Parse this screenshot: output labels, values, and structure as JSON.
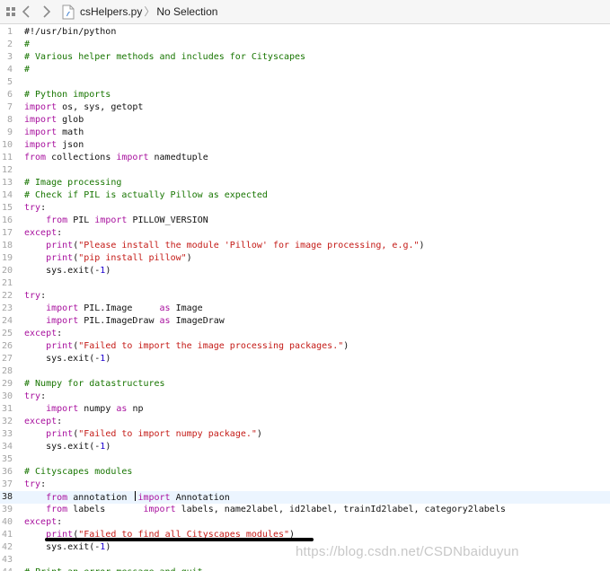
{
  "toolbar": {
    "file_name": "csHelpers.py",
    "breadcrumb_sep": "〉",
    "selection": "No Selection",
    "icons": [
      "grid-icon",
      "back-arrow-icon",
      "forward-arrow-icon",
      "python-file-icon"
    ]
  },
  "editor": {
    "current_line": 38,
    "lines": [
      {
        "n": "1",
        "tokens": [
          [
            "t",
            "#!/usr/bin/python"
          ]
        ]
      },
      {
        "n": "2",
        "tokens": [
          [
            "c",
            "#"
          ]
        ]
      },
      {
        "n": "3",
        "tokens": [
          [
            "c",
            "# Various helper methods and includes for Cityscapes"
          ]
        ]
      },
      {
        "n": "4",
        "tokens": [
          [
            "c",
            "#"
          ]
        ]
      },
      {
        "n": "5",
        "tokens": []
      },
      {
        "n": "6",
        "tokens": [
          [
            "c",
            "# Python imports"
          ]
        ]
      },
      {
        "n": "7",
        "tokens": [
          [
            "k",
            "import"
          ],
          [
            "t",
            " os, sys, getopt"
          ]
        ]
      },
      {
        "n": "8",
        "tokens": [
          [
            "k",
            "import"
          ],
          [
            "t",
            " glob"
          ]
        ]
      },
      {
        "n": "9",
        "tokens": [
          [
            "k",
            "import"
          ],
          [
            "t",
            " math"
          ]
        ]
      },
      {
        "n": "10",
        "tokens": [
          [
            "k",
            "import"
          ],
          [
            "t",
            " json"
          ]
        ]
      },
      {
        "n": "11",
        "tokens": [
          [
            "k",
            "from"
          ],
          [
            "t",
            " collections "
          ],
          [
            "k",
            "import"
          ],
          [
            "t",
            " namedtuple"
          ]
        ]
      },
      {
        "n": "12",
        "tokens": []
      },
      {
        "n": "13",
        "tokens": [
          [
            "c",
            "# Image processing"
          ]
        ]
      },
      {
        "n": "14",
        "tokens": [
          [
            "c",
            "# Check if PIL is actually Pillow as expected"
          ]
        ]
      },
      {
        "n": "15",
        "tokens": [
          [
            "k",
            "try"
          ],
          [
            "t",
            ":"
          ]
        ]
      },
      {
        "n": "16",
        "tokens": [
          [
            "t",
            "    "
          ],
          [
            "k",
            "from"
          ],
          [
            "t",
            " PIL "
          ],
          [
            "k",
            "import"
          ],
          [
            "t",
            " PILLOW_VERSION"
          ]
        ]
      },
      {
        "n": "17",
        "tokens": [
          [
            "k",
            "except"
          ],
          [
            "t",
            ":"
          ]
        ]
      },
      {
        "n": "18",
        "tokens": [
          [
            "t",
            "    "
          ],
          [
            "k",
            "print"
          ],
          [
            "t",
            "("
          ],
          [
            "s",
            "\"Please install the module 'Pillow' for image processing, e.g.\""
          ],
          [
            "t",
            ")"
          ]
        ]
      },
      {
        "n": "19",
        "tokens": [
          [
            "t",
            "    "
          ],
          [
            "k",
            "print"
          ],
          [
            "t",
            "("
          ],
          [
            "s",
            "\"pip install pillow\""
          ],
          [
            "t",
            ")"
          ]
        ]
      },
      {
        "n": "20",
        "tokens": [
          [
            "t",
            "    sys.exit(-"
          ],
          [
            "n",
            "1"
          ],
          [
            "t",
            ")"
          ]
        ]
      },
      {
        "n": "21",
        "tokens": []
      },
      {
        "n": "22",
        "tokens": [
          [
            "k",
            "try"
          ],
          [
            "t",
            ":"
          ]
        ]
      },
      {
        "n": "23",
        "tokens": [
          [
            "t",
            "    "
          ],
          [
            "k",
            "import"
          ],
          [
            "t",
            " PIL.Image     "
          ],
          [
            "k",
            "as"
          ],
          [
            "t",
            " Image"
          ]
        ]
      },
      {
        "n": "24",
        "tokens": [
          [
            "t",
            "    "
          ],
          [
            "k",
            "import"
          ],
          [
            "t",
            " PIL.ImageDraw "
          ],
          [
            "k",
            "as"
          ],
          [
            "t",
            " ImageDraw"
          ]
        ]
      },
      {
        "n": "25",
        "tokens": [
          [
            "k",
            "except"
          ],
          [
            "t",
            ":"
          ]
        ]
      },
      {
        "n": "26",
        "tokens": [
          [
            "t",
            "    "
          ],
          [
            "k",
            "print"
          ],
          [
            "t",
            "("
          ],
          [
            "s",
            "\"Failed to import the image processing packages.\""
          ],
          [
            "t",
            ")"
          ]
        ]
      },
      {
        "n": "27",
        "tokens": [
          [
            "t",
            "    sys.exit(-"
          ],
          [
            "n",
            "1"
          ],
          [
            "t",
            ")"
          ]
        ]
      },
      {
        "n": "28",
        "tokens": []
      },
      {
        "n": "29",
        "tokens": [
          [
            "c",
            "# Numpy for datastructures"
          ]
        ]
      },
      {
        "n": "30",
        "tokens": [
          [
            "k",
            "try"
          ],
          [
            "t",
            ":"
          ]
        ]
      },
      {
        "n": "31",
        "tokens": [
          [
            "t",
            "    "
          ],
          [
            "k",
            "import"
          ],
          [
            "t",
            " numpy "
          ],
          [
            "k",
            "as"
          ],
          [
            "t",
            " np"
          ]
        ]
      },
      {
        "n": "32",
        "tokens": [
          [
            "k",
            "except"
          ],
          [
            "t",
            ":"
          ]
        ]
      },
      {
        "n": "33",
        "tokens": [
          [
            "t",
            "    "
          ],
          [
            "k",
            "print"
          ],
          [
            "t",
            "("
          ],
          [
            "s",
            "\"Failed to import numpy package.\""
          ],
          [
            "t",
            ")"
          ]
        ]
      },
      {
        "n": "34",
        "tokens": [
          [
            "t",
            "    sys.exit(-"
          ],
          [
            "n",
            "1"
          ],
          [
            "t",
            ")"
          ]
        ]
      },
      {
        "n": "35",
        "tokens": []
      },
      {
        "n": "36",
        "tokens": [
          [
            "c",
            "# Cityscapes modules"
          ]
        ]
      },
      {
        "n": "37",
        "tokens": [
          [
            "k",
            "try"
          ],
          [
            "t",
            ":"
          ]
        ]
      },
      {
        "n": "38",
        "tokens": [
          [
            "t",
            "    "
          ],
          [
            "k",
            "from"
          ],
          [
            "t",
            " annotation "
          ],
          [
            "caret",
            ""
          ],
          [
            "k",
            "import"
          ],
          [
            "t",
            " Annotation"
          ]
        ]
      },
      {
        "n": "39",
        "tokens": [
          [
            "t",
            "    "
          ],
          [
            "k",
            "from"
          ],
          [
            "t",
            " labels       "
          ],
          [
            "k",
            "import"
          ],
          [
            "t",
            " labels, name2label, id2label, trainId2label, category2labels"
          ]
        ]
      },
      {
        "n": "40",
        "tokens": [
          [
            "k",
            "except"
          ],
          [
            "t",
            ":"
          ]
        ]
      },
      {
        "n": "41",
        "tokens": [
          [
            "t",
            "    "
          ],
          [
            "k",
            "print"
          ],
          [
            "t",
            "("
          ],
          [
            "s",
            "\"Failed to find all Cityscapes modules\""
          ],
          [
            "t",
            ")"
          ]
        ]
      },
      {
        "n": "42",
        "tokens": [
          [
            "t",
            "    sys.exit(-"
          ],
          [
            "n",
            "1"
          ],
          [
            "t",
            ")"
          ]
        ]
      },
      {
        "n": "43",
        "tokens": []
      },
      {
        "n": "44",
        "tokens": [
          [
            "c",
            "# Print an error message and quit"
          ]
        ]
      }
    ]
  },
  "watermark": "https://blog.csdn.net/CSDNbaiduyun"
}
